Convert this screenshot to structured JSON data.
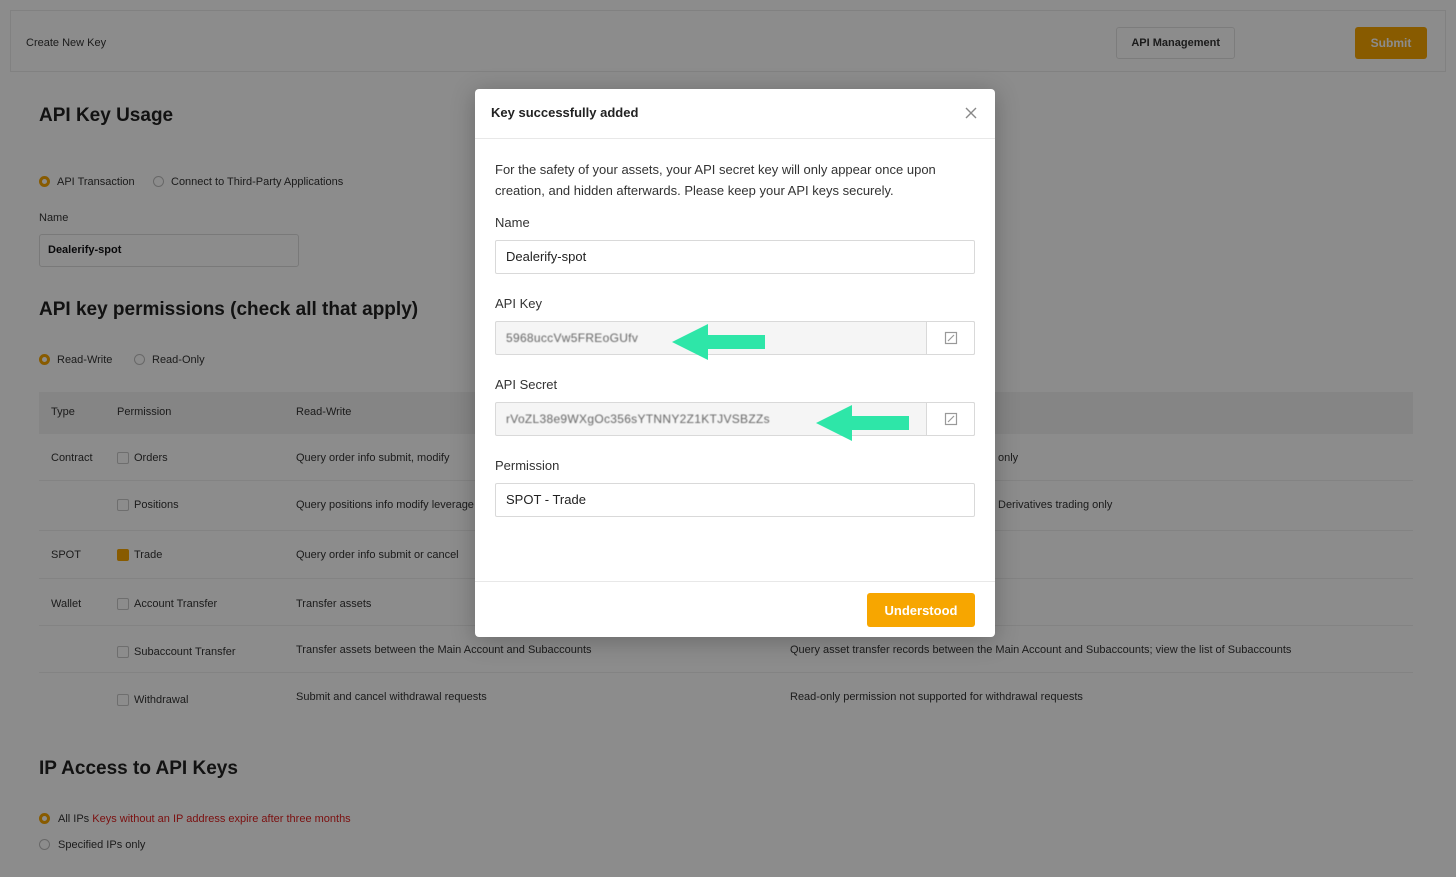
{
  "background": {
    "breadcrumb": "Create New Key",
    "api_management_label": "API Management",
    "submit_label": "Submit",
    "usage_title": "API Key Usage",
    "usage_options": [
      "API Transaction",
      "Connect to Third-Party Applications"
    ],
    "name_label": "Name",
    "name_value": "Dealerify-spot",
    "permissions_title": "API key permissions (check all that apply)",
    "access_options": [
      "Read-Write",
      "Read-Only"
    ],
    "table_headers": [
      "Type",
      "Permission",
      "Read-Write"
    ],
    "rows": [
      {
        "type": "Contract",
        "permission": "Orders",
        "desc": "Query order info submit, modify",
        "note": "only"
      },
      {
        "type": "",
        "permission": "Positions",
        "desc": "Query positions info modify leverage",
        "note": "Derivatives trading only"
      },
      {
        "type": "SPOT",
        "permission": "Trade",
        "desc": "Query order info submit or cancel",
        "note": ""
      },
      {
        "type": "Wallet",
        "permission": "Account Transfer",
        "desc": "Transfer assets",
        "note": ""
      },
      {
        "type": "",
        "permission": "Subaccount Transfer",
        "desc": "Transfer assets between the Main Account and Subaccounts",
        "note": "Query asset transfer records between the Main Account and Subaccounts; view the list of Subaccounts"
      },
      {
        "type": "",
        "permission": "Withdrawal",
        "desc": "Submit and cancel withdrawal requests",
        "note": "Read-only permission not supported for withdrawal requests"
      }
    ],
    "ip_title": "IP Access to API Keys",
    "ip_all_label": "All IPs",
    "ip_warning": "Keys without an IP address expire after three months",
    "ip_specified_label": "Specified IPs only"
  },
  "modal": {
    "title": "Key successfully added",
    "notice": "For the safety of your assets, your API secret key will only appear once upon creation, and hidden afterwards. Please keep your API keys securely.",
    "name_label": "Name",
    "name_value": "Dealerify-spot",
    "api_key_label": "API Key",
    "api_key_value": "5968uccVw5FREoGUfv",
    "api_secret_label": "API Secret",
    "api_secret_value": "rVoZL38e9WXgOc356sYTNNY2Z1KTJVSBZZs",
    "permission_label": "Permission",
    "permission_value": "SPOT - Trade",
    "understood_label": "Understood"
  },
  "colors": {
    "accent": "#f7a600",
    "arrow": "#2ee6a8",
    "overlay": "rgba(0,0,0,0.45)"
  }
}
